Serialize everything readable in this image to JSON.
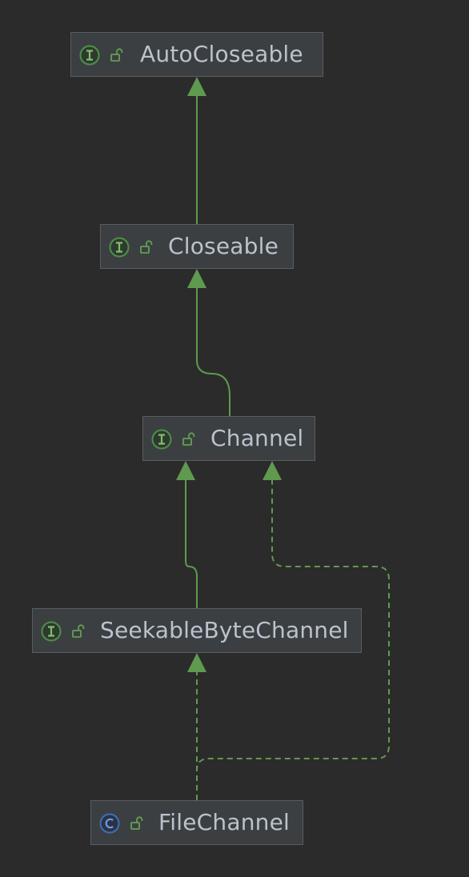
{
  "diagram": {
    "type": "uml-class-hierarchy",
    "nodes": [
      {
        "id": "autocloseable",
        "label": "AutoCloseable",
        "kind": "interface",
        "visibility": "public"
      },
      {
        "id": "closeable",
        "label": "Closeable",
        "kind": "interface",
        "visibility": "public"
      },
      {
        "id": "channel",
        "label": "Channel",
        "kind": "interface",
        "visibility": "public"
      },
      {
        "id": "seekable",
        "label": "SeekableByteChannel",
        "kind": "interface",
        "visibility": "public"
      },
      {
        "id": "filechannel",
        "label": "FileChannel",
        "kind": "class",
        "visibility": "public"
      }
    ],
    "edges": [
      {
        "from": "closeable",
        "to": "autocloseable",
        "type": "extends",
        "style": "solid"
      },
      {
        "from": "channel",
        "to": "closeable",
        "type": "extends",
        "style": "solid"
      },
      {
        "from": "seekable",
        "to": "channel",
        "type": "extends",
        "style": "solid"
      },
      {
        "from": "filechannel",
        "to": "seekable",
        "type": "implements",
        "style": "dashed"
      },
      {
        "from": "filechannel",
        "to": "channel",
        "type": "implements",
        "style": "dashed"
      }
    ]
  },
  "icons": {
    "interface": "interface-icon",
    "class": "class-icon",
    "visibility": "public-unlock-icon"
  },
  "colors": {
    "background": "#2b2b2b",
    "node_fill": "#3c3f41",
    "node_border": "#5a5d60",
    "label_text": "#b9c3cf",
    "edge": "#5f9a4e",
    "interface_icon": "#4e8f4c",
    "class_icon": "#3d6fb8",
    "visibility_icon": "#62a152"
  }
}
